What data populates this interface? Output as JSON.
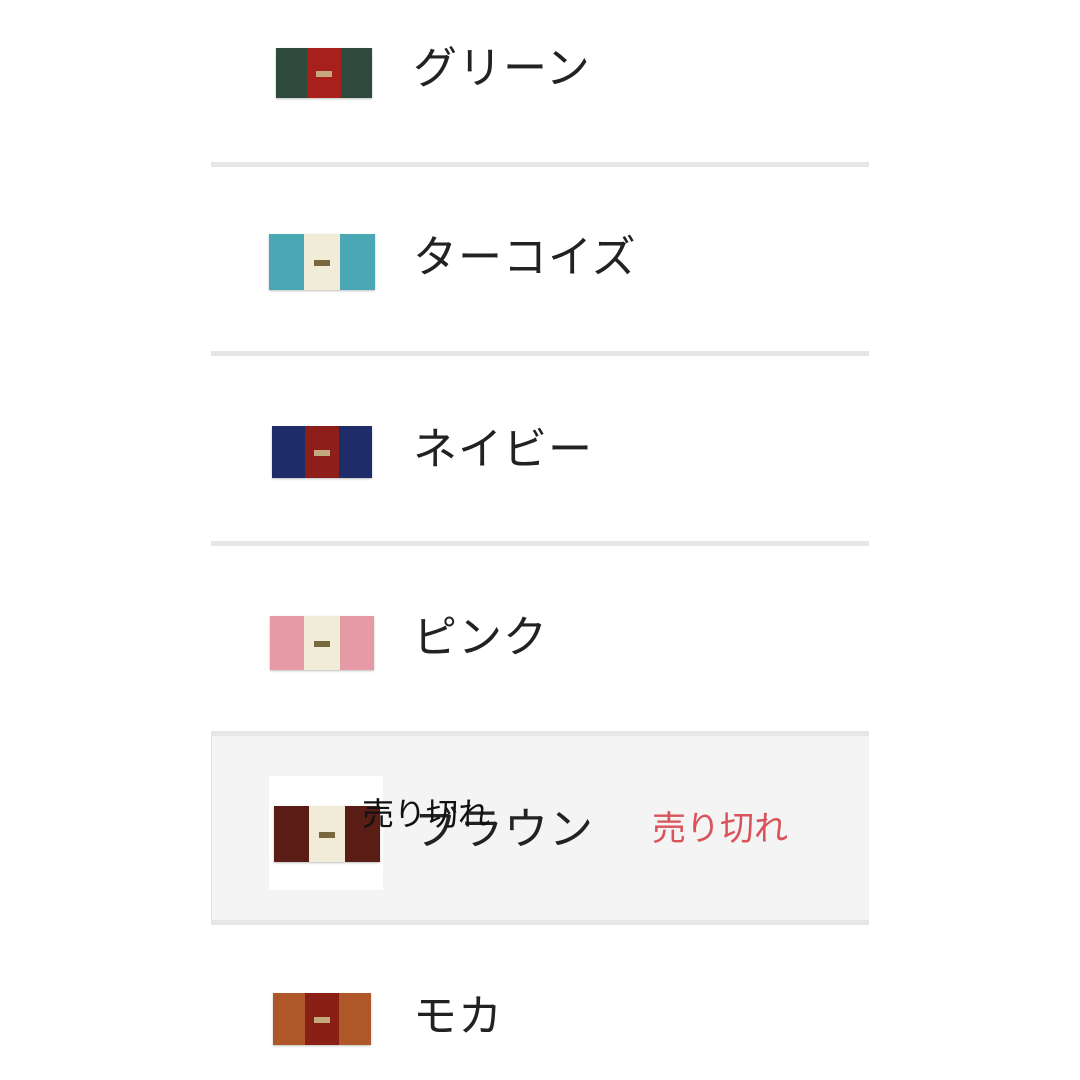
{
  "colors": {
    "sold_out": "#d9535b",
    "divider": "#e6e6e6",
    "text": "#222222"
  },
  "variants": [
    {
      "name": "グリーン",
      "swatch": [
        "#2e4a3c",
        "#a8201c",
        "#2e4a3c"
      ]
    },
    {
      "name": "ターコイズ",
      "swatch": [
        "#4aa8b4",
        "#f1ecd8",
        "#4aa8b4"
      ]
    },
    {
      "name": "ネイビー",
      "swatch": [
        "#1f2c6a",
        "#8e1e1a",
        "#1f2c6a"
      ]
    },
    {
      "name": "ピンク",
      "swatch": [
        "#e59aa5",
        "#f1ecd8",
        "#e59aa5"
      ]
    },
    {
      "name": "ブラウン",
      "swatch": [
        "#5a1d15",
        "#f1ecd8",
        "#5a1d15"
      ],
      "status": "売り切れ",
      "overlay": "売り切れ"
    },
    {
      "name": "モカ",
      "swatch": [
        "#b0572a",
        "#8a1f16",
        "#b0572a"
      ]
    }
  ]
}
